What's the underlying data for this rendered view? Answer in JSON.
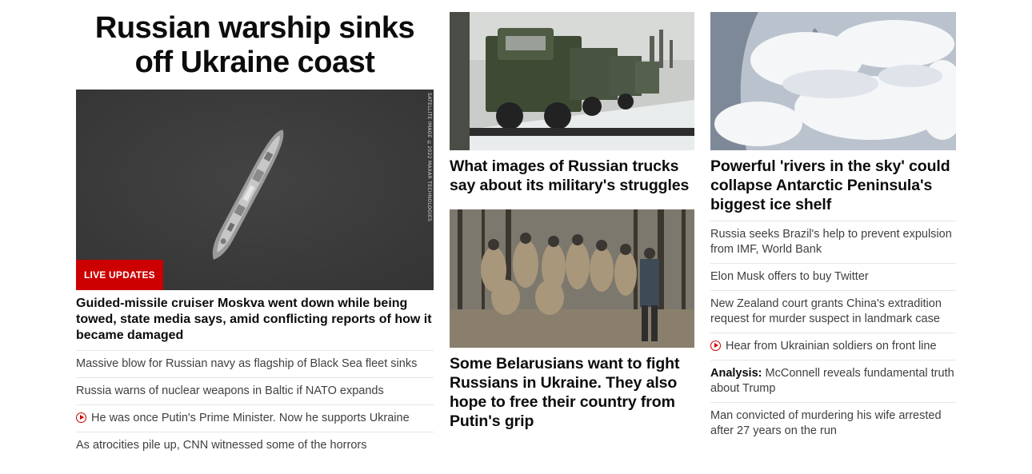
{
  "left": {
    "headline": "Russian warship sinks off Ukraine coast",
    "image_badge": "LIVE UPDATES",
    "image_credit": "SATELLITE IMAGE ©2022 MAXAR TECHNOLOGIES",
    "lead_title": "Guided-missile cruiser Moskva went down while being towed, state media says, amid conflicting reports of how it became damaged",
    "links": [
      {
        "text": "Massive blow for Russian navy as flagship of Black Sea fleet sinks",
        "video": false
      },
      {
        "text": "Russia warns of nuclear weapons in Baltic if NATO expands",
        "video": false
      },
      {
        "text": "He was once Putin's Prime Minister. Now he supports Ukraine",
        "video": true
      },
      {
        "text": "As atrocities pile up, CNN witnessed some of the horrors",
        "video": false
      }
    ]
  },
  "middle": {
    "card1_title": "What images of Russian trucks say about its military's struggles",
    "card2_title": "Some Belarusians want to fight Russians in Ukraine. They also hope to free their country from Putin's grip"
  },
  "right": {
    "card_title": "Powerful 'rivers in the sky' could collapse Antarctic Peninsula's biggest ice shelf",
    "links": [
      {
        "prefix": "",
        "text": "Russia seeks Brazil's help to prevent expulsion from IMF, World Bank",
        "video": false
      },
      {
        "prefix": "",
        "text": "Elon Musk offers to buy Twitter",
        "video": false
      },
      {
        "prefix": "",
        "text": "New Zealand court grants China's extradition request for murder suspect in landmark case",
        "video": false
      },
      {
        "prefix": "",
        "text": "Hear from Ukrainian soldiers on front line",
        "video": true
      },
      {
        "prefix": "Analysis:",
        "text": " McConnell reveals fundamental truth about Trump",
        "video": false
      },
      {
        "prefix": "",
        "text": "Man convicted of murdering his wife arrested after 27 years on the run",
        "video": false
      }
    ]
  },
  "colors": {
    "accent_red": "#cc0000",
    "text_dark": "#0c0c0c",
    "text_link": "#404040",
    "divider": "#e6e6e6"
  },
  "icons": {
    "video": "play-circle-icon"
  }
}
